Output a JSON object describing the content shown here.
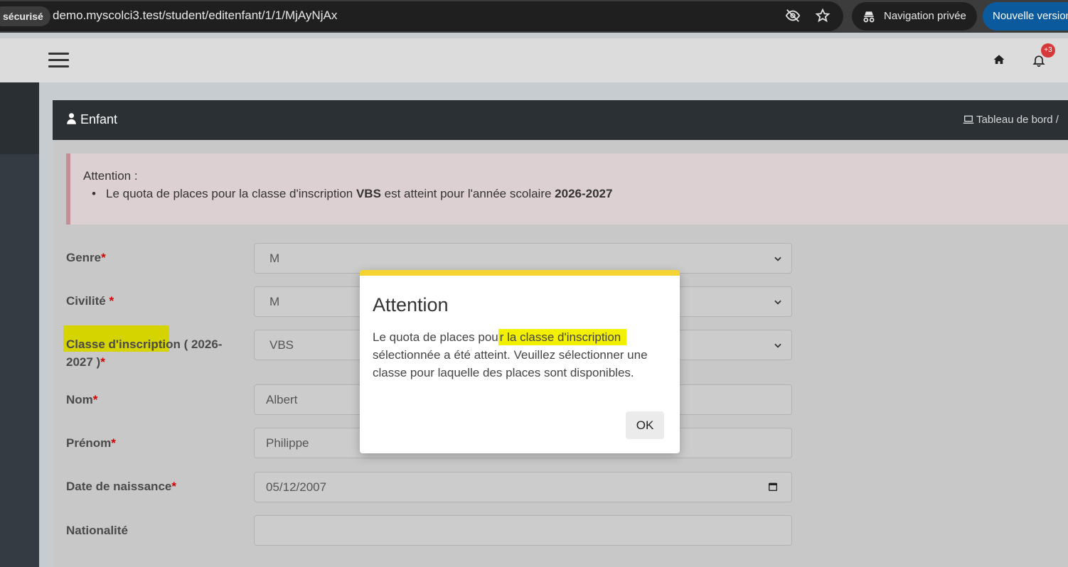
{
  "browser": {
    "security_label": "sécurisé",
    "url": "demo.myscolci3.test/student/editenfant/1/1/MjAyNjAx",
    "private_label": "Navigation privée",
    "new_version_label": "Nouvelle version"
  },
  "header": {
    "notification_count": "+3"
  },
  "card": {
    "title": "Enfant",
    "breadcrumb": "Tableau de bord /"
  },
  "alert": {
    "title": "Attention :",
    "message_prefix": "Le quota de places pour la classe d'inscription ",
    "class_name": "VBS",
    "message_middle": " est atteint pour l'année scolaire ",
    "year": "2026-2027"
  },
  "form": {
    "genre": {
      "label": "Genre",
      "required": "*",
      "value": "M"
    },
    "civilite": {
      "label": "Civilité ",
      "required": "*",
      "value": "M"
    },
    "classe": {
      "label_line1": "Classe d'inscription ( 2026-",
      "label_line2": "2027 )",
      "required": "*",
      "value": "VBS"
    },
    "nom": {
      "label": "Nom",
      "required": "*",
      "value": "Albert"
    },
    "prenom": {
      "label": "Prénom",
      "required": "*",
      "value": "Philippe"
    },
    "naissance": {
      "label": "Date de naissance",
      "required": "*",
      "value": "05/12/2007"
    },
    "nationalite": {
      "label": "Nationalité",
      "value": ""
    }
  },
  "modal": {
    "title": "Attention",
    "body_prefix": "Le quota de places pou",
    "body_highlight": "r la classe d'inscription",
    "body_suffix": " sélectionnée a été atteint. Veuillez sélectionner une classe pour laquelle des places sont disponibles.",
    "ok_label": "OK"
  },
  "colors": {
    "modal_accent": "#f4d431",
    "highlight": "#f3f100",
    "required": "#d40000",
    "badge": "#d6393a"
  }
}
